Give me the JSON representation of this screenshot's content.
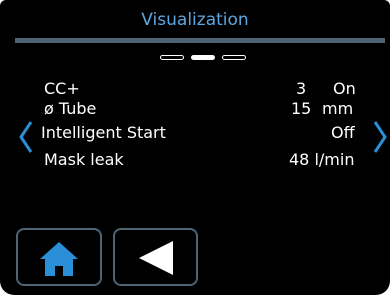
{
  "header": {
    "title": "Visualization"
  },
  "pager": {
    "count": 3,
    "active": 2
  },
  "rows": [
    {
      "label": "CC+",
      "value": "3",
      "unit": "On"
    },
    {
      "label": "ø  Tube",
      "value": "15",
      "unit": "mm"
    },
    {
      "label": "Intelligent Start",
      "value": "Off",
      "unit": ""
    },
    {
      "label": "Mask leak",
      "value": "48 l/min",
      "unit": ""
    }
  ],
  "icons": {
    "prev": "chevron-left-icon",
    "next": "chevron-right-icon",
    "home": "home-icon",
    "back": "back-triangle-icon"
  },
  "colors": {
    "accent": "#2a8fd6",
    "title": "#5ea7e0",
    "bar": "#4d6573",
    "background": "#000000",
    "text": "#ffffff"
  }
}
